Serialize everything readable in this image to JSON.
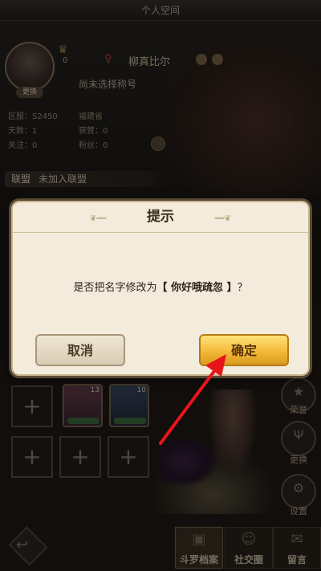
{
  "window": {
    "title": "个人空间"
  },
  "profile": {
    "avatar_change_label": "更换",
    "rank_value": "0",
    "name": "柳真比尔",
    "title_status": "尚未选择称号",
    "info": {
      "server_label": "区服：",
      "server_value": "S2450",
      "region_value": "福建省",
      "days_label": "天数：",
      "days_value": "1",
      "likes_label": "获赞：",
      "likes_value": "0",
      "follow_label": "关注：",
      "follow_value": "0",
      "fans_label": "粉丝：",
      "fans_value": "0"
    },
    "alliance_label": "联盟",
    "alliance_value": "未加入联盟"
  },
  "team": {
    "hero_levels": [
      "13",
      "10"
    ]
  },
  "side_buttons": [
    {
      "label": "荣誉",
      "icon": "star-icon"
    },
    {
      "label": "更换",
      "icon": "trident-icon"
    },
    {
      "label": "设置",
      "icon": "gear-icon"
    }
  ],
  "bottom_tabs": [
    {
      "label": "斗罗档案",
      "icon": "archive-icon"
    },
    {
      "label": "社交圈",
      "icon": "people-icon"
    },
    {
      "label": "留言",
      "icon": "message-icon"
    }
  ],
  "dialog": {
    "title": "提示",
    "message_prefix": "是否把名字修改为",
    "message_name": "【 你好哦疏忽 】",
    "message_suffix": "？",
    "cancel_label": "取消",
    "confirm_label": "确定"
  },
  "colors": {
    "accent_gold": "#f1b534",
    "dialog_bg": "#f3ecdc",
    "arrow_red": "#e8141b"
  }
}
